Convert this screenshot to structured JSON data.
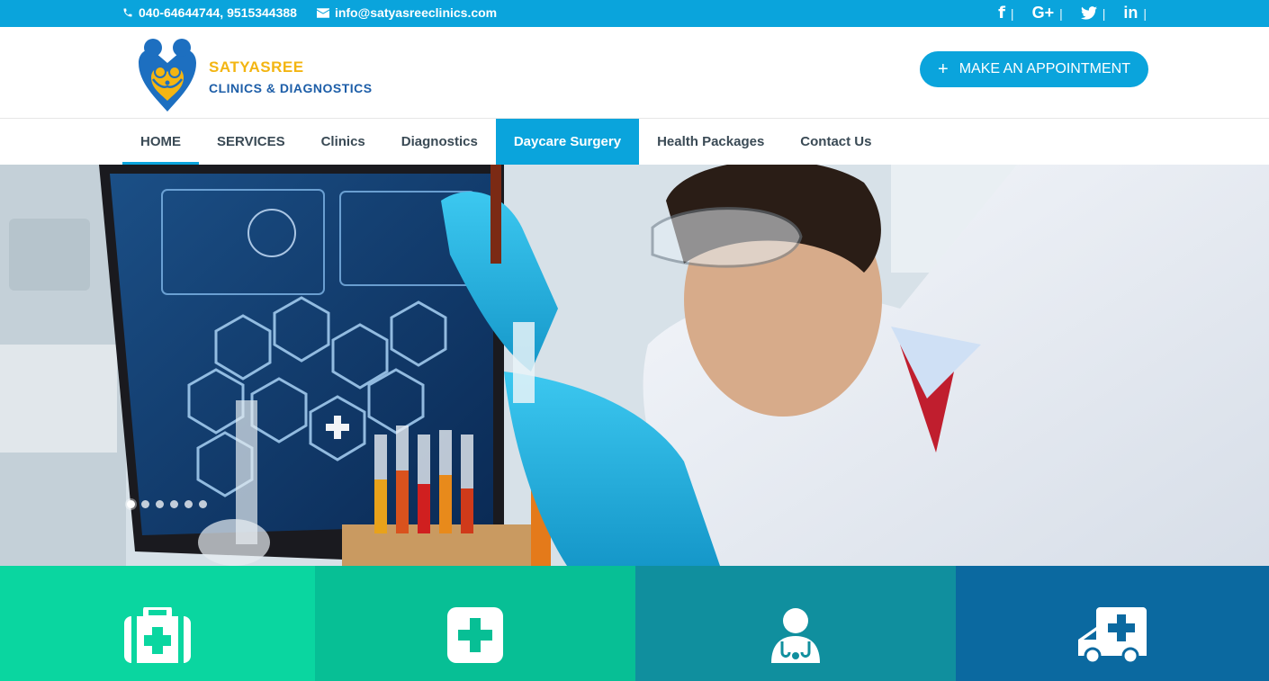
{
  "topbar": {
    "phone": "040-64644744, 9515344388",
    "email": "info@satyasreeclinics.com",
    "social": [
      {
        "label": "f",
        "icon": "facebook-icon"
      },
      {
        "label": "G+",
        "icon": "google-plus-icon"
      },
      {
        "label": "twitter",
        "icon": "twitter-icon"
      },
      {
        "label": "in",
        "icon": "linkedin-icon"
      }
    ],
    "separator": "|"
  },
  "brand": {
    "name_line1": "SATYASREE",
    "name_line2": "CLINICS & DIAGNOSTICS"
  },
  "cta": {
    "plus": "+",
    "label": "MAKE AN APPOINTMENT"
  },
  "nav": {
    "items": [
      {
        "label": "HOME"
      },
      {
        "label": "SERVICES"
      },
      {
        "label": "Clinics"
      },
      {
        "label": "Diagnostics"
      },
      {
        "label": "Daycare Surgery"
      },
      {
        "label": "Health Packages"
      },
      {
        "label": "Contact Us"
      }
    ]
  },
  "hero": {
    "slide_count": 6,
    "active_slide": 1
  },
  "features": [
    {
      "icon": "first-aid-kit-icon",
      "color": "#0ad6a0"
    },
    {
      "icon": "medical-cross-icon",
      "color": "#07bf95"
    },
    {
      "icon": "doctor-icon",
      "color": "#108f9e"
    },
    {
      "icon": "ambulance-icon",
      "color": "#0b69a0"
    }
  ],
  "colors": {
    "accent": "#0aa4dc",
    "brand_yellow": "#f3b512",
    "brand_blue": "#1d5ea8",
    "nav_text": "#3a4a55"
  }
}
